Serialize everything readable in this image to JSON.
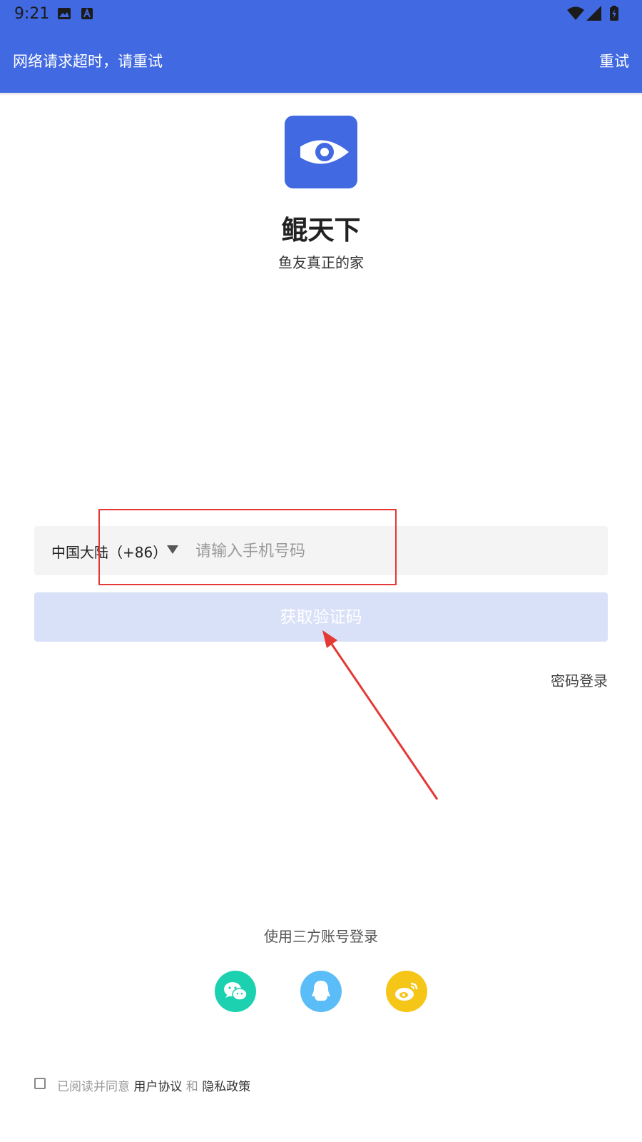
{
  "status_bar": {
    "time": "9:21"
  },
  "banner": {
    "message": "网络请求超时，请重试",
    "action": "重试"
  },
  "app": {
    "name": "鲲天下",
    "slogan": "鱼友真正的家"
  },
  "login": {
    "country": "中国大陆（+86）",
    "phone_placeholder": "请输入手机号码",
    "get_code_label": "获取验证码",
    "password_login_label": "密码登录"
  },
  "third_party": {
    "title": "使用三方账号登录",
    "providers": [
      {
        "icon": "wechat-icon",
        "color": "#1BD1B0"
      },
      {
        "icon": "qq-icon",
        "color": "#5BBDF7"
      },
      {
        "icon": "weibo-icon",
        "color": "#F5C518"
      }
    ]
  },
  "agreement": {
    "prefix": "已阅读并同意 ",
    "user_agreement": "用户协议",
    "and": " 和 ",
    "privacy_policy": "隐私政策"
  },
  "colors": {
    "primary": "#4169E1",
    "button_disabled": "#D9E1F8",
    "annotation": "#e53935"
  }
}
